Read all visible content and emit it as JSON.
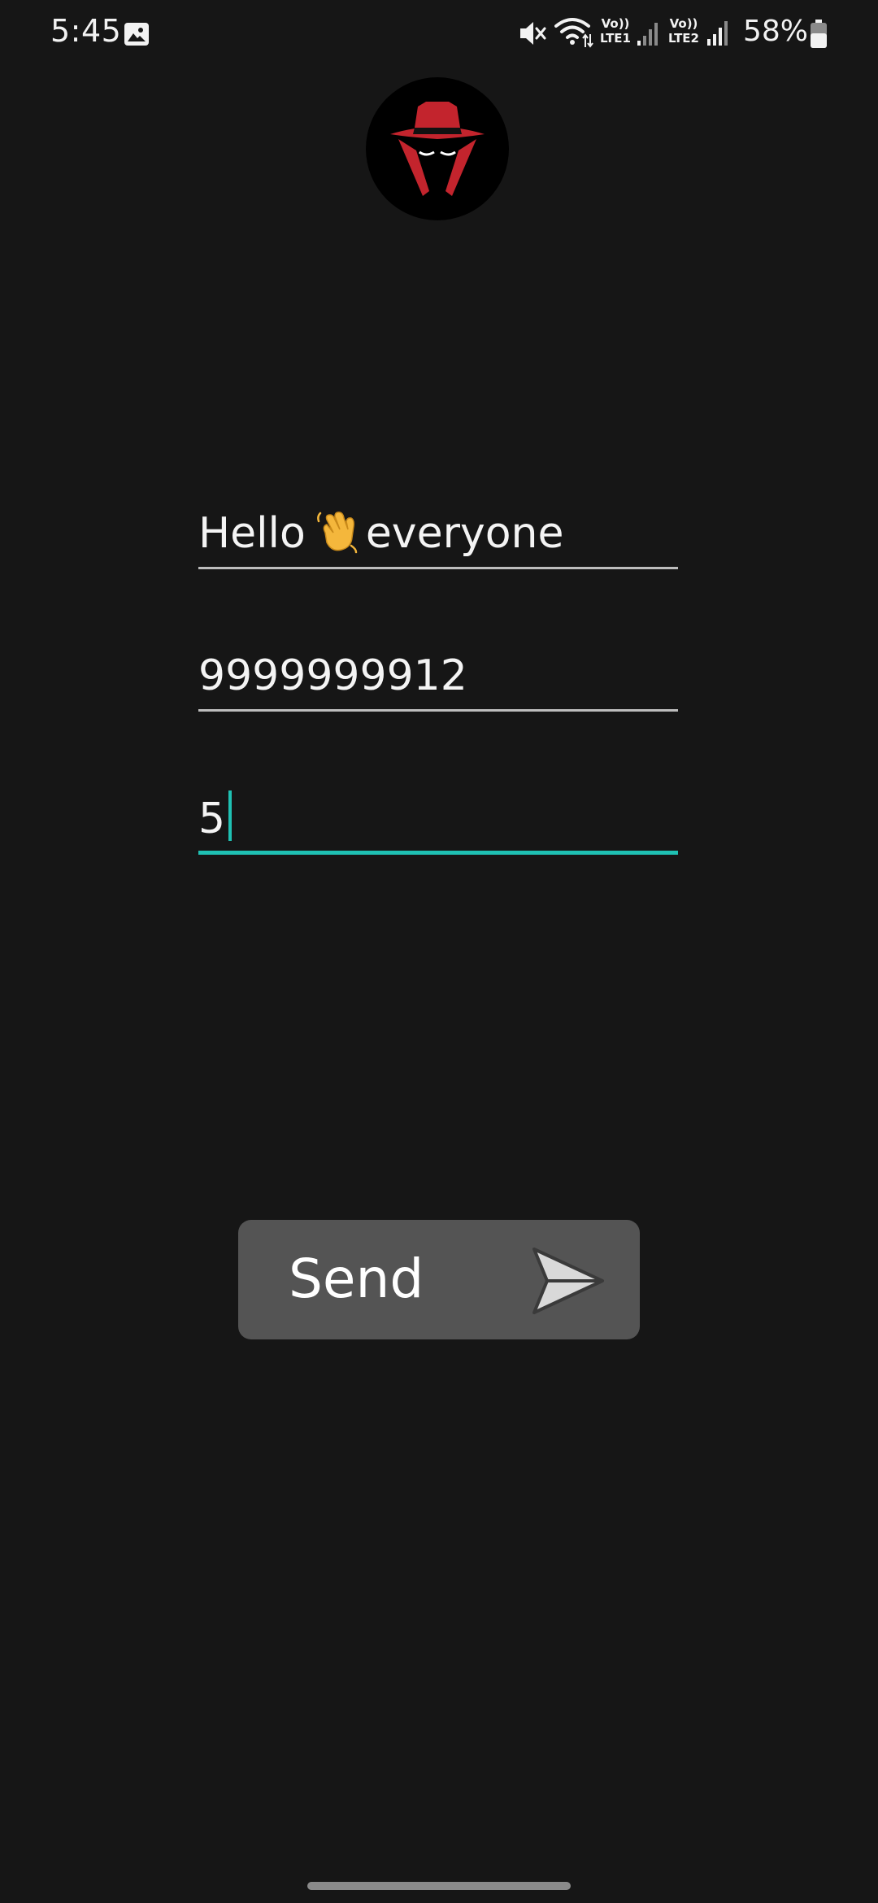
{
  "status_bar": {
    "time": "5:45",
    "battery_percent": "58%",
    "lte1_label": "LTE1",
    "lte2_label": "LTE2",
    "volte_label": "Vo))",
    "icons": [
      "gallery-icon",
      "mute-icon",
      "wifi-icon",
      "signal-icon",
      "battery-icon"
    ]
  },
  "avatar": {
    "icon": "spy-avatar-icon",
    "colors": {
      "hat": "#c3242d",
      "background": "#000000"
    }
  },
  "form": {
    "message": {
      "value_before_emoji": "Hello",
      "emoji": "👋",
      "value_after_emoji": "everyone"
    },
    "phone": {
      "value": "9999999912"
    },
    "count": {
      "value": "5"
    }
  },
  "send_button": {
    "label": "Send",
    "icon": "send-icon"
  },
  "colors": {
    "background": "#161616",
    "accent": "#1fc1b3",
    "button": "#545454"
  }
}
